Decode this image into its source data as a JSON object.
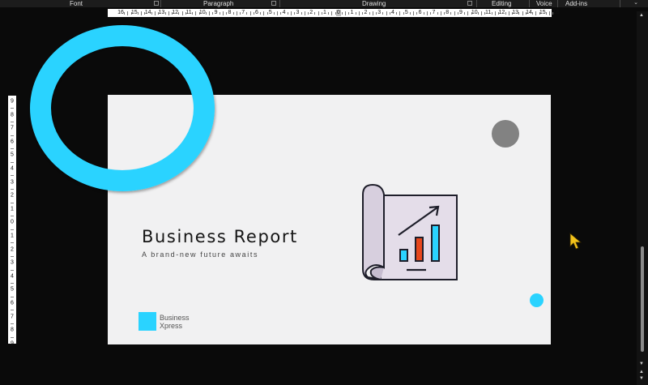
{
  "ribbon": {
    "groups": {
      "font": "Font",
      "paragraph": "Paragraph",
      "drawing": "Drawing",
      "editing": "Editing",
      "voice": "Voice",
      "addins": "Add-ins"
    }
  },
  "ruler": {
    "horizontal_labels": [
      "16",
      "15",
      "14",
      "13",
      "12",
      "11",
      "10",
      "9",
      "8",
      "7",
      "6",
      "5",
      "4",
      "3",
      "2",
      "1",
      "0",
      "1",
      "2",
      "3",
      "4",
      "5",
      "6",
      "7",
      "8",
      "9",
      "10",
      "11",
      "12",
      "13",
      "14",
      "15",
      "16"
    ],
    "vertical_labels": [
      "9",
      "8",
      "7",
      "6",
      "5",
      "4",
      "3",
      "2",
      "1",
      "0",
      "1",
      "2",
      "3",
      "4",
      "5",
      "6",
      "7",
      "8",
      "9"
    ]
  },
  "slide": {
    "title": "Business Report",
    "subtitle": "A brand-new future awaits",
    "logo_line1": "Business",
    "logo_line2": "Xpress"
  },
  "colors": {
    "accent_cyan": "#2ad3ff",
    "gray_dot": "#828282",
    "bar_red": "#e8471c",
    "icon_fill": "#e4dde9",
    "cursor_yellow": "#f2c21b"
  },
  "icons": {
    "report": "bar-chart-scroll-icon",
    "cursor": "mouse-pointer-icon"
  }
}
